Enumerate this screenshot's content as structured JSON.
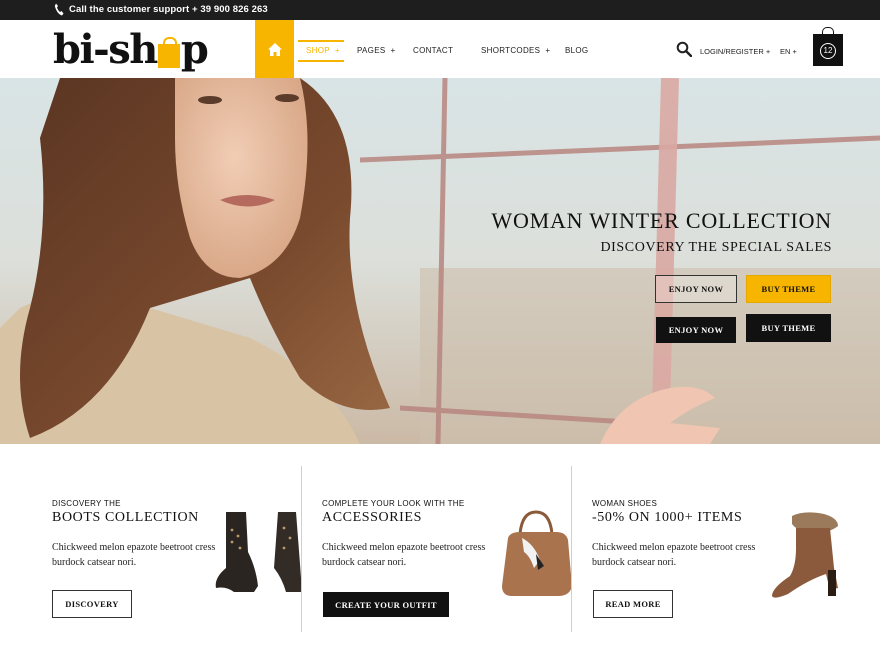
{
  "topbar": {
    "support": "Call the customer support + 39 900 826 263"
  },
  "brand": {
    "logo_left": "bi-sh",
    "logo_right": "p",
    "accent": "#f7b500"
  },
  "nav": {
    "home_icon": "home-icon",
    "items": [
      {
        "label": "SHOP",
        "plus": "+"
      },
      {
        "label": "PAGES",
        "plus": "+"
      },
      {
        "label": "CONTACT",
        "plus": ""
      },
      {
        "label": "SHORTCODES",
        "plus": "+"
      },
      {
        "label": "BLOG",
        "plus": ""
      }
    ],
    "login": "LOGIN/REGISTER +",
    "lang": "EN +",
    "cart_count": "12"
  },
  "hero": {
    "title": "WOMAN WINTER COLLECTION",
    "subtitle": "DISCOVERY THE SPECIAL SALES",
    "buttons": {
      "enjoy_outline": "ENJOY NOW",
      "buy_yellow": "BUY THEME",
      "enjoy_black": "ENJOY NOW",
      "buy_black": "BUY THEME"
    }
  },
  "promos": [
    {
      "eyebrow": "DISCOVERY THE",
      "title": "BOOTS COLLECTION",
      "text": "Chickweed melon epazote beetroot cress burdock catsear nori.",
      "button": "DISCOVERY"
    },
    {
      "eyebrow": "COMPLETE YOUR LOOK WITH THE",
      "title": "ACCESSORIES",
      "text": "Chickweed melon epazote beetroot cress burdock catsear nori.",
      "button": "CREATE YOUR OUTFIT"
    },
    {
      "eyebrow": "WOMAN SHOES",
      "title": "-50% ON 1000+  ITEMS",
      "text": "Chickweed melon epazote beetroot cress burdock catsear nori.",
      "button": "READ MORE"
    }
  ]
}
